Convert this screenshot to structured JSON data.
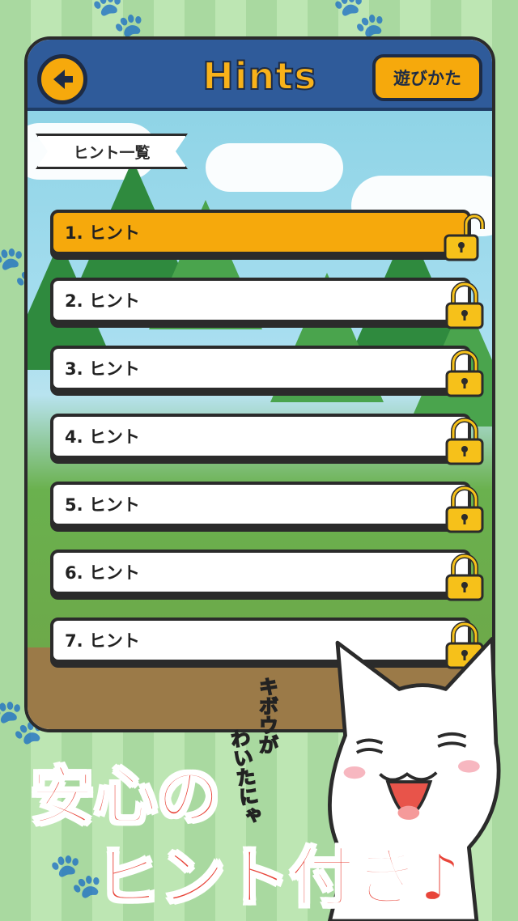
{
  "header": {
    "back_icon": "arrow-left-icon",
    "title": "Hints",
    "howto_label": "遊びかた"
  },
  "section_label": "ヒント一覧",
  "hints": [
    {
      "label": "1. ヒント",
      "state": "unlocked"
    },
    {
      "label": "2. ヒント",
      "state": "locked"
    },
    {
      "label": "3. ヒント",
      "state": "locked"
    },
    {
      "label": "4. ヒント",
      "state": "locked"
    },
    {
      "label": "5. ヒント",
      "state": "locked"
    },
    {
      "label": "6. ヒント",
      "state": "locked"
    },
    {
      "label": "7. ヒント",
      "state": "locked"
    }
  ],
  "promo": {
    "line1": "安心の",
    "line2": "ヒント付き♪"
  },
  "cat_speech": {
    "line1": "キボウが",
    "line2": "わいたにゃ"
  },
  "colors": {
    "accent": "#f6a90c",
    "header": "#2f5b9a",
    "promo_text": "#e8453a"
  }
}
